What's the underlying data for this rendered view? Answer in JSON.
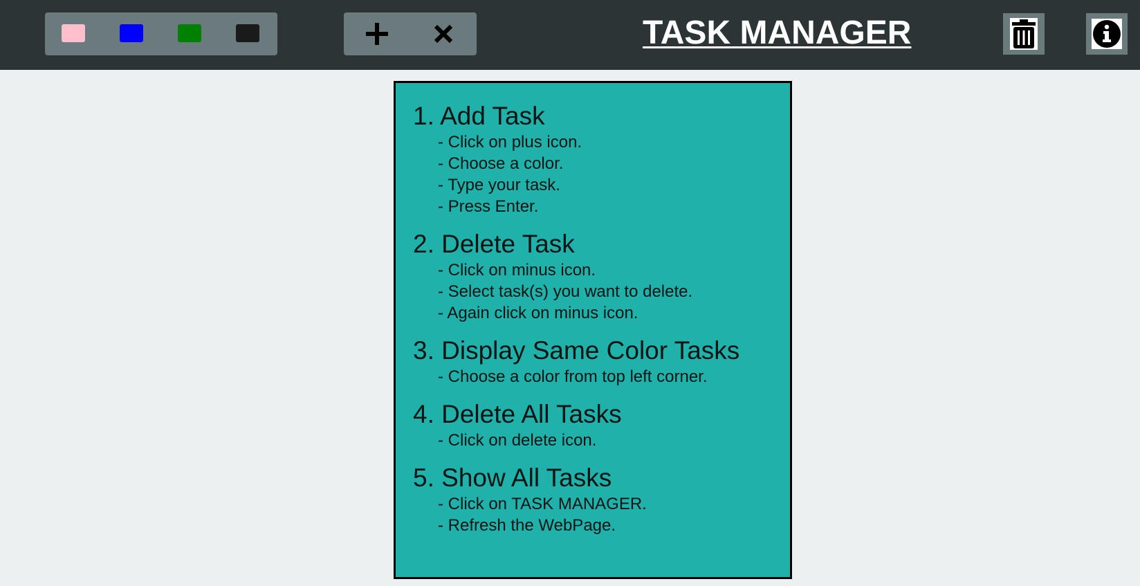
{
  "header": {
    "title": "TASK MANAGER",
    "swatches": [
      {
        "name": "pink",
        "color": "#ffc0cb"
      },
      {
        "name": "blue",
        "color": "#0000ff"
      },
      {
        "name": "green",
        "color": "#008000"
      },
      {
        "name": "black",
        "color": "#1a1a1a"
      }
    ],
    "actions": {
      "add_icon": "plus-icon",
      "remove_icon": "x-icon"
    },
    "delete_icon": "trash-icon",
    "info_icon": "info-icon"
  },
  "instructions": {
    "sections": [
      {
        "heading": "1. Add Task",
        "steps": [
          "- Click on plus icon.",
          "- Choose a color.",
          "- Type your task.",
          "- Press Enter."
        ]
      },
      {
        "heading": "2. Delete Task",
        "steps": [
          "- Click on minus icon.",
          "- Select task(s) you want to delete.",
          "- Again click on minus icon."
        ]
      },
      {
        "heading": "3. Display Same Color Tasks",
        "steps": [
          "- Choose a color from top left corner."
        ]
      },
      {
        "heading": "4. Delete All Tasks",
        "steps": [
          "- Click on delete icon."
        ]
      },
      {
        "heading": "5. Show All Tasks",
        "steps": [
          "- Click on TASK MANAGER.",
          "- Refresh the WebPage."
        ]
      }
    ]
  },
  "colors": {
    "topbar": "#2d3436",
    "panel": "#6b7b7d",
    "background": "#ecf0f1",
    "info_box": "#20b2aa"
  }
}
